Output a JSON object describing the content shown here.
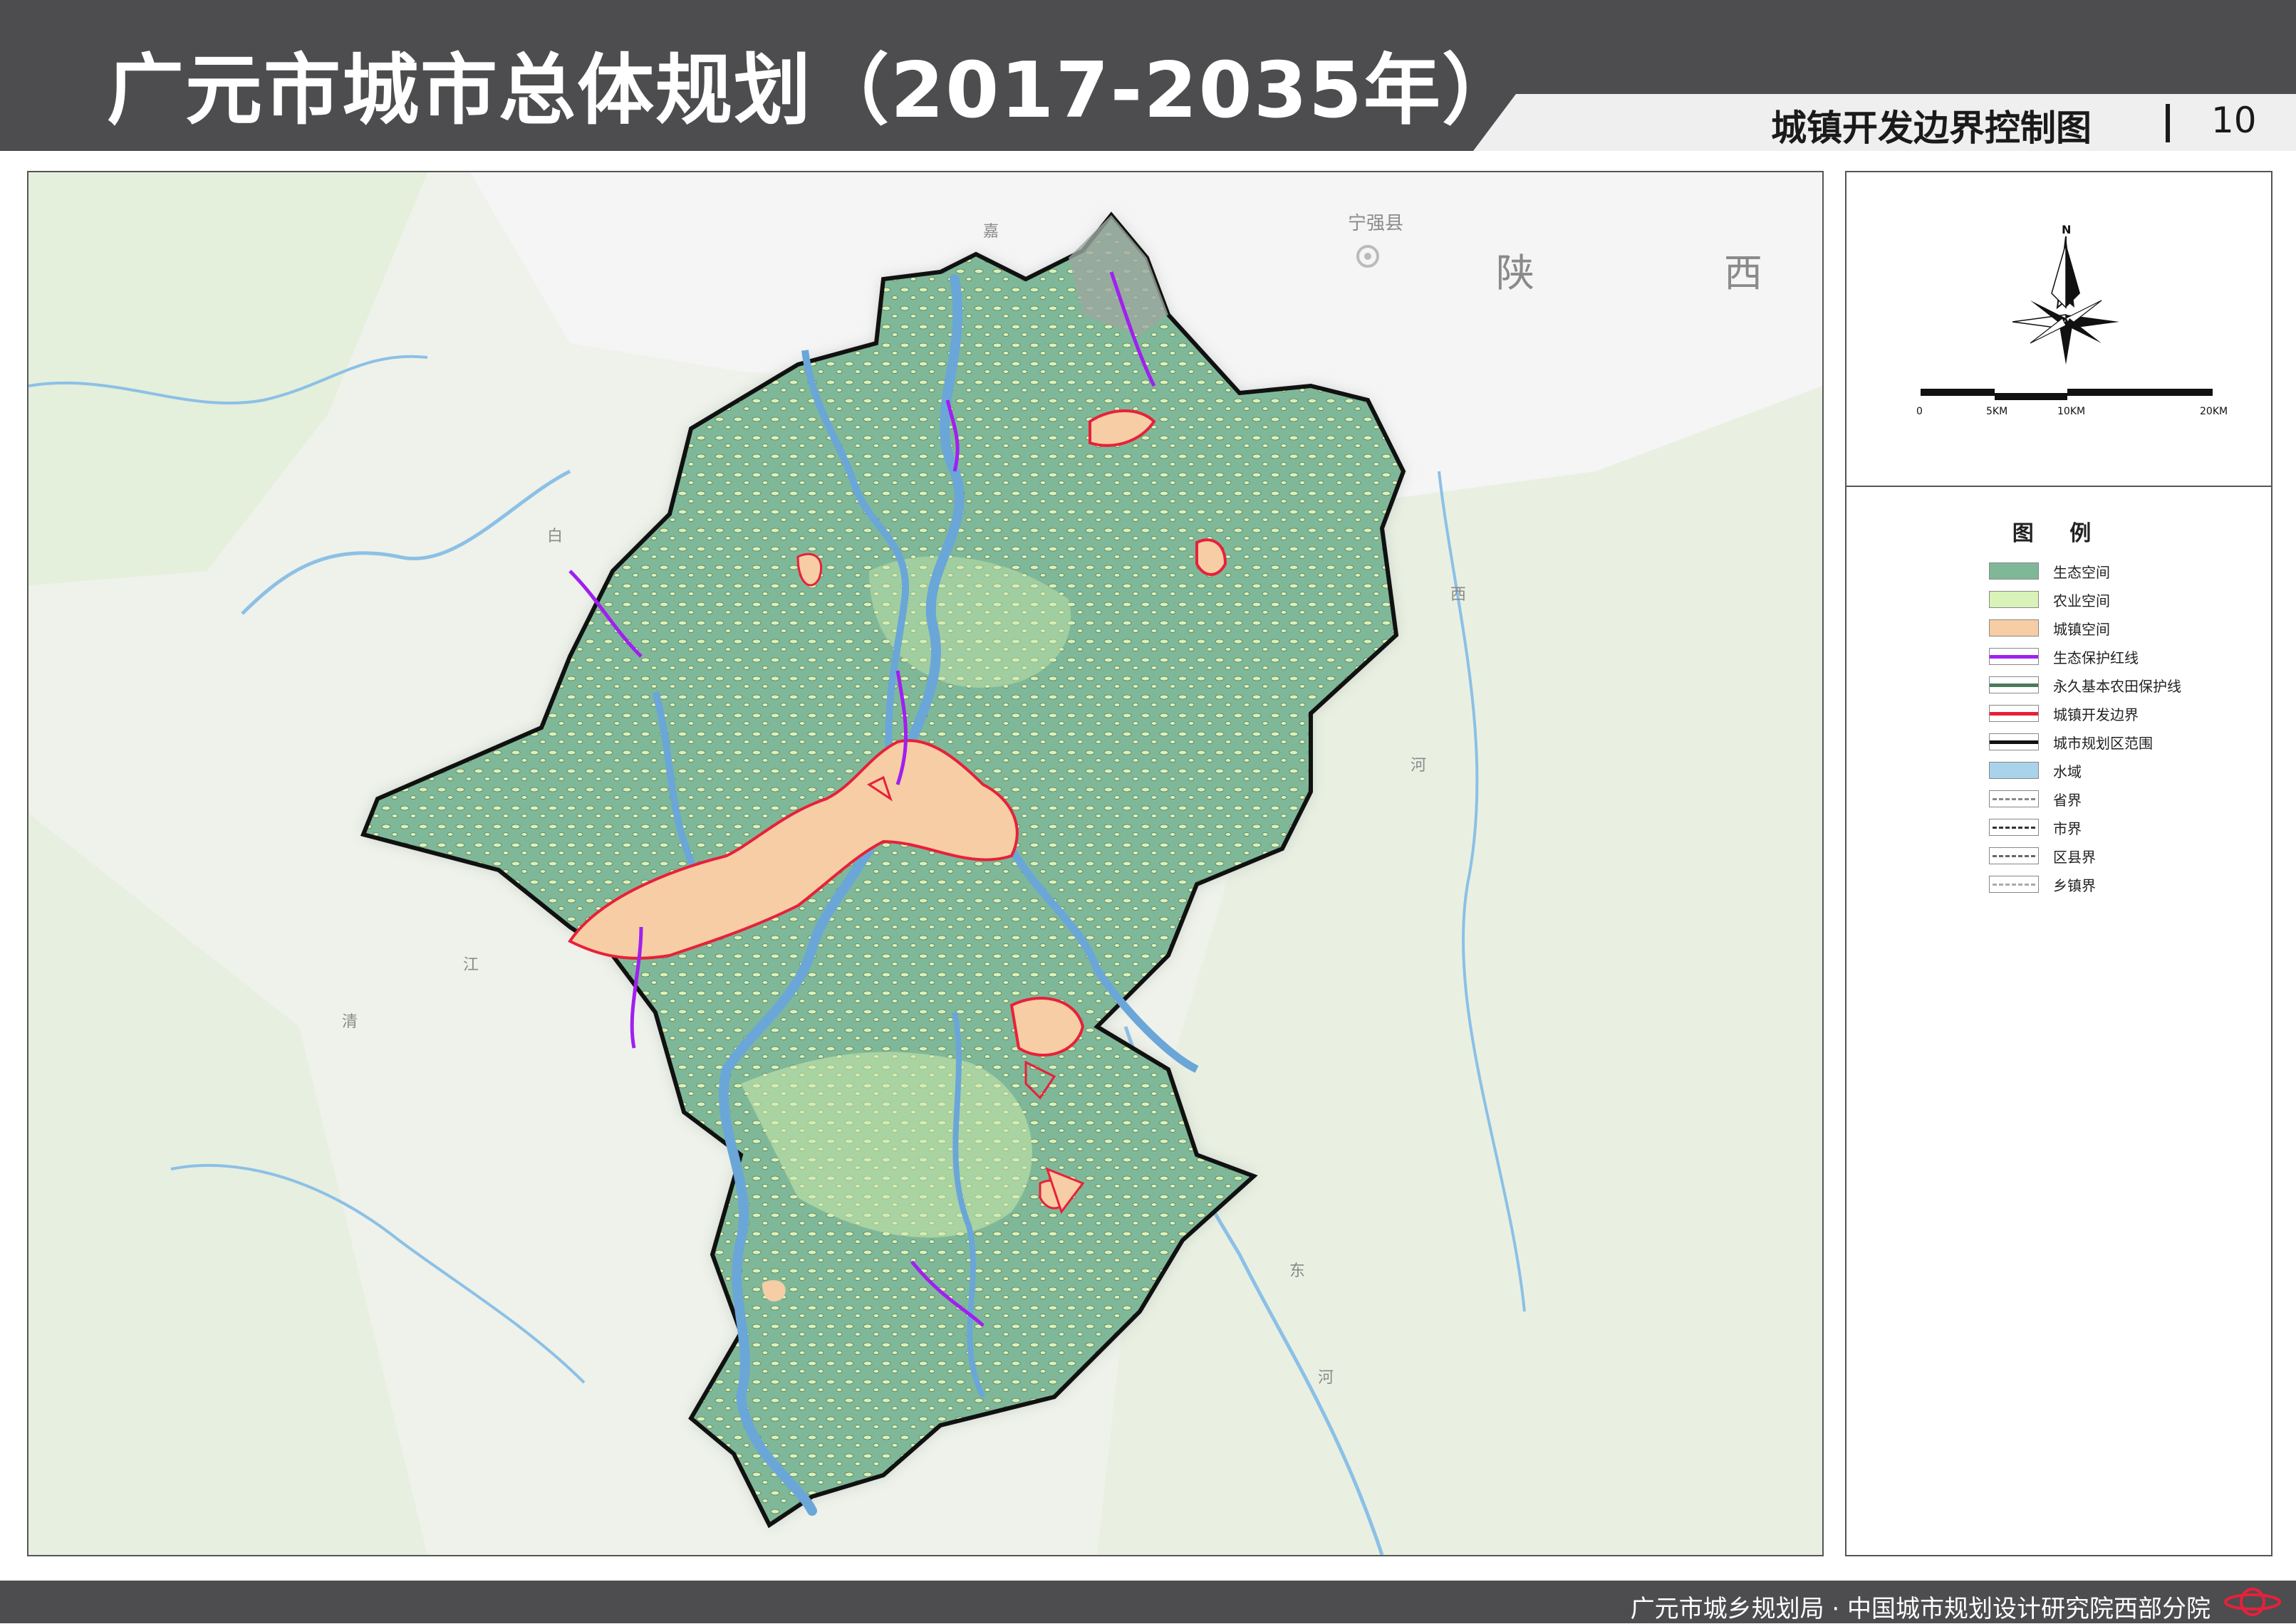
{
  "header": {
    "title": "广元市城市总体规划（2017-2035年）",
    "subtitle": "城镇开发边界控制图",
    "page_number": "10",
    "background_color": "#4d4d4f"
  },
  "map": {
    "place_labels": {
      "ningqiang": "宁强县",
      "shaan": "陕",
      "xi": "西",
      "jia": "嘉",
      "bai": "白",
      "qing": "清",
      "jiang": "江",
      "xi2": "西",
      "he": "河",
      "dong": "东",
      "he2": "河"
    },
    "colors": {
      "ecological": "#7fb898",
      "agricultural": "#d8f2b8",
      "urban": "#f6cda5",
      "eco_redline": "#a020f0",
      "dev_boundary": "#e8203a",
      "planning_area": "#111111",
      "water": "#6ba6d8",
      "background": "#f2f4ef"
    }
  },
  "compass": {
    "north_label": "N",
    "scale_labels": [
      "0",
      "5KM",
      "10KM",
      "20KM"
    ]
  },
  "legend": {
    "title": "图 例",
    "items": [
      {
        "label": "生态空间",
        "type": "fill",
        "color": "#7fb898"
      },
      {
        "label": "农业空间",
        "type": "fill",
        "color": "#d8f2b8"
      },
      {
        "label": "城镇空间",
        "type": "fill",
        "color": "#f6cda5"
      },
      {
        "label": "生态保护红线",
        "type": "line",
        "color": "#a020f0"
      },
      {
        "label": "永久基本农田保护线",
        "type": "line",
        "color": "#4a7a5a"
      },
      {
        "label": "城镇开发边界",
        "type": "line",
        "color": "#e8203a"
      },
      {
        "label": "城市规划区范围",
        "type": "line",
        "color": "#111111"
      },
      {
        "label": "水域",
        "type": "fill",
        "color": "#a9d3ea"
      },
      {
        "label": "省界",
        "type": "dash",
        "color": "#888888"
      },
      {
        "label": "市界",
        "type": "dash",
        "color": "#333333"
      },
      {
        "label": "区县界",
        "type": "dash",
        "color": "#666666"
      },
      {
        "label": "乡镇界",
        "type": "dash",
        "color": "#aaaaaa"
      }
    ]
  },
  "footer": {
    "text": "广元市城乡规划局 · 中国城市规划设计研究院西部分院"
  }
}
